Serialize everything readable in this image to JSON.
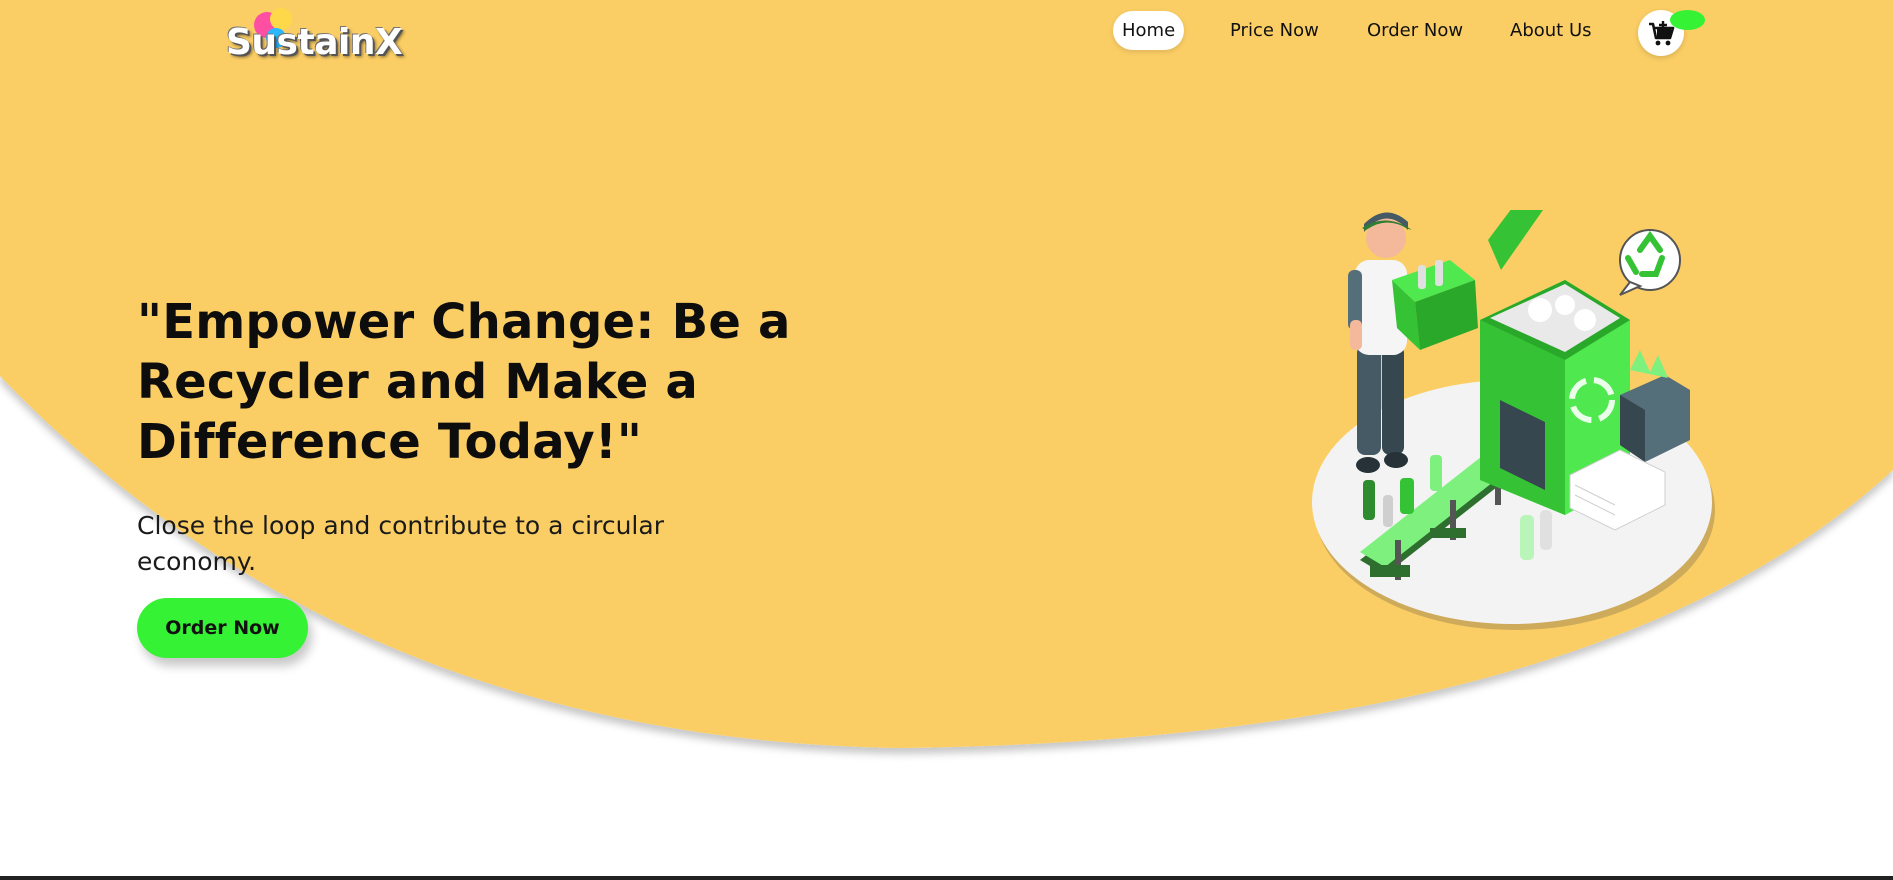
{
  "brand": {
    "name": "SustainX"
  },
  "nav": {
    "items": [
      {
        "label": "Home",
        "active": true
      },
      {
        "label": "Price Now",
        "active": false
      },
      {
        "label": "Order Now",
        "active": false
      },
      {
        "label": "About Us",
        "active": false
      }
    ],
    "cart_icon": "cart-plus-icon"
  },
  "hero": {
    "title": "\"Empower Change: Be a Recycler and Make a Difference Today!\"",
    "subtitle": "Close the loop and contribute to a circular economy.",
    "cta_label": "Order Now",
    "illustration": "recycling-worker-illustration"
  },
  "colors": {
    "hero_background": "#FBCE65",
    "accent_green": "#35F234",
    "text_dark": "#0D0D0D",
    "page_background": "#FFFFFF"
  }
}
